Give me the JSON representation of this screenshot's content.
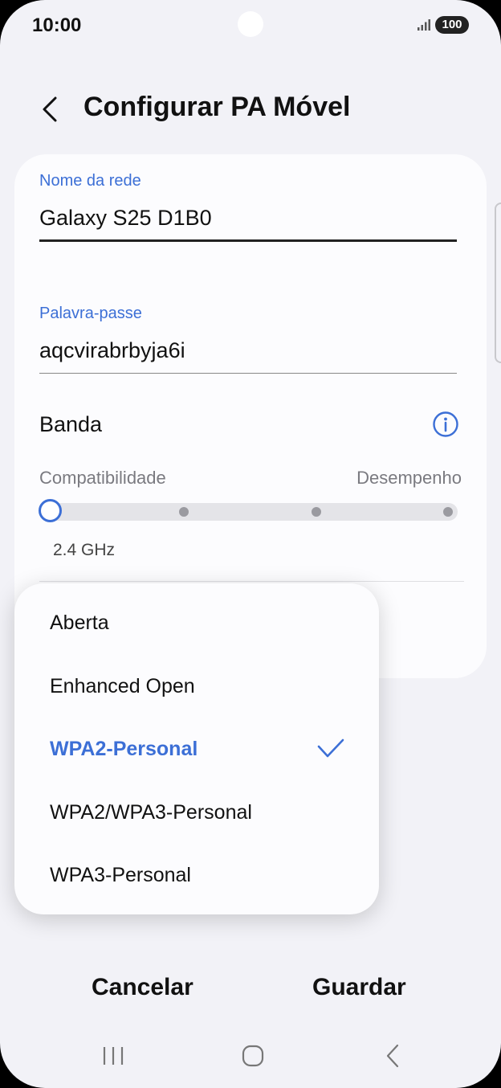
{
  "status_bar": {
    "time": "10:00",
    "battery": "100",
    "signal_icon": "signal-icon"
  },
  "header": {
    "back_icon": "back-arrow-icon",
    "title": "Configurar PA Móvel"
  },
  "form": {
    "network_name": {
      "label": "Nome da rede",
      "value": "Galaxy S25 D1B0"
    },
    "password": {
      "label": "Palavra-passe",
      "value": "aqcvirabrbyja6i"
    },
    "band": {
      "label": "Banda",
      "info_icon": "info-icon",
      "left_label": "Compatibilidade",
      "right_label": "Desempenho",
      "selected_value": "2.4 GHz",
      "selected_step": 1,
      "steps": 4
    }
  },
  "security_menu": {
    "options": [
      {
        "label": "Aberta",
        "selected": false
      },
      {
        "label": "Enhanced Open",
        "selected": false
      },
      {
        "label": "WPA2-Personal",
        "selected": true
      },
      {
        "label": "WPA2/WPA3-Personal",
        "selected": false
      },
      {
        "label": "WPA3-Personal",
        "selected": false
      }
    ],
    "check_icon": "checkmark-icon"
  },
  "actions": {
    "cancel": "Cancelar",
    "save": "Guardar"
  },
  "colors": {
    "accent": "#3c6fd6",
    "background": "#f2f2f7",
    "card": "#fcfcfe"
  }
}
